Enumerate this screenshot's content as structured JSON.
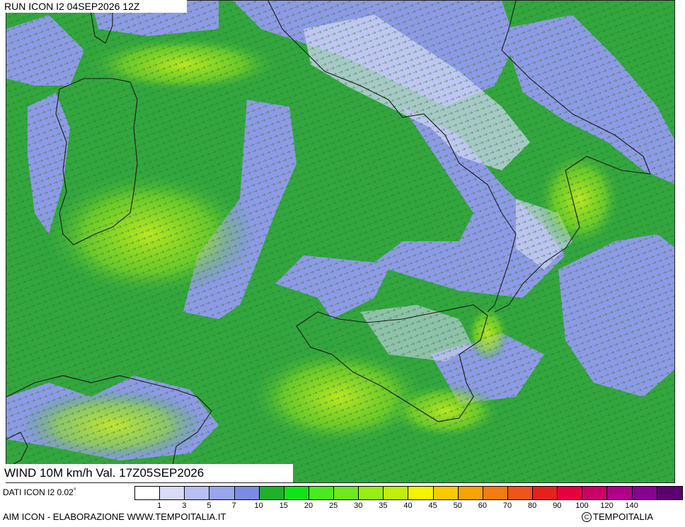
{
  "header": {
    "run_label": "RUN ICON I2 04SEP2026 12Z"
  },
  "map": {
    "variable_label": "WIND 10M km/h Val. 17Z05SEP2026"
  },
  "footer": {
    "data_source": "DATI ICON I2 0.02",
    "degree_symbol": "°",
    "credit": "AIM ICON - ELABORAZIONE WWW.TEMPOITALIA.IT",
    "copyright_symbol": "C",
    "brand": "TEMPOITALIA"
  },
  "legend": {
    "unit": "km/h",
    "colors": [
      "#ffffff",
      "#d8dcf7",
      "#b8c0f2",
      "#9aa6ec",
      "#7c8ae4",
      "#1fb12a",
      "#0fe515",
      "#47ec20",
      "#6ee81f",
      "#96ee12",
      "#c0f00a",
      "#f4f400",
      "#fbc900",
      "#f7a300",
      "#f47c10",
      "#f05418",
      "#e8201c",
      "#e80040",
      "#cc0066",
      "#b0008a",
      "#8a0090",
      "#5c0070"
    ],
    "labels": [
      "1",
      "3",
      "5",
      "7",
      "10",
      "15",
      "20",
      "25",
      "30",
      "35",
      "40",
      "45",
      "50",
      "60",
      "70",
      "80",
      "90",
      "100",
      "120",
      "140"
    ]
  }
}
